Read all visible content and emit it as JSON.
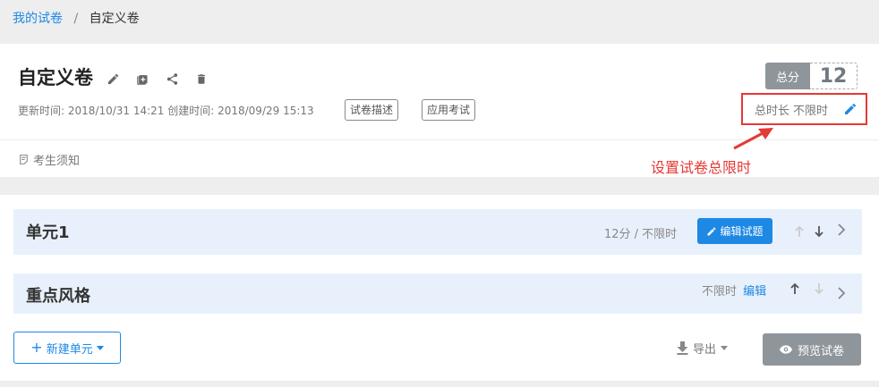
{
  "breadcrumb": {
    "parent": "我的试卷",
    "separator": "/",
    "current": "自定义卷"
  },
  "paper": {
    "title": "自定义卷",
    "meta": "更新时间: 2018/10/31 14:21 创建时间: 2018/09/29 15:13",
    "tag_description": "试卷描述",
    "tag_apply": "应用考试",
    "score_label": "总分",
    "score_value": "12",
    "time_label": "总时长",
    "time_value": "不限时",
    "notice": "考生须知"
  },
  "annotation": {
    "text": "设置试卷总限时",
    "color": "#e53935"
  },
  "units": [
    {
      "name": "单元1",
      "info": "12分 / 不限时",
      "edit_button": "编辑试题"
    },
    {
      "name": "重点风格",
      "info": "不限时",
      "edit_link": "编辑"
    }
  ],
  "actions": {
    "new_unit": "新建单元",
    "export": "导出",
    "preview": "预览试卷"
  },
  "colors": {
    "accent": "#1e88e5",
    "annotation": "#e53935",
    "score_bg": "#8e959b"
  },
  "icons": [
    "pencil-icon",
    "add-box-icon",
    "share-icon",
    "trash-icon",
    "document-icon",
    "arrow-up-icon",
    "arrow-down-icon",
    "chevron-right-icon",
    "download-icon",
    "eye-icon",
    "caret-down-icon",
    "plus-icon"
  ]
}
